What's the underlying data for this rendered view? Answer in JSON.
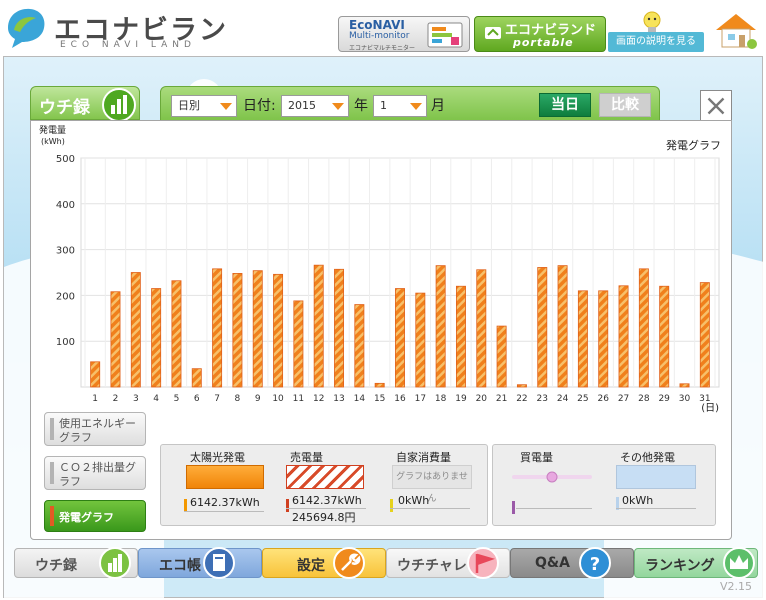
{
  "header": {
    "logo_title": "エコナビランド",
    "logo_sub": "ECO NAVI LAND",
    "econavi": {
      "line1": "EcoNAVI",
      "line2": "Multi-monitor",
      "line3": "エコナビマルチモニター"
    },
    "portable": {
      "line1": "エコナビランド",
      "line2": "portable"
    },
    "help_label": "画面の説明を見る"
  },
  "main_tab": {
    "label": "ウチ録"
  },
  "controls": {
    "period_value": "日別",
    "date_label": "日付:",
    "year_value": "2015",
    "year_unit": "年",
    "month_value": "1",
    "month_unit": "月",
    "today_label": "当日",
    "compare_label": "比較"
  },
  "chart_data": {
    "type": "bar",
    "title": "発電グラフ",
    "ylabel": "発電量",
    "yunit": "(kWh)",
    "xlabel": "(日)",
    "ylim": [
      0,
      500
    ],
    "yticks": [
      100,
      200,
      300,
      400,
      500
    ],
    "grid": true,
    "categories": [
      "1",
      "2",
      "3",
      "4",
      "5",
      "6",
      "7",
      "8",
      "9",
      "10",
      "11",
      "12",
      "13",
      "14",
      "15",
      "16",
      "17",
      "18",
      "19",
      "20",
      "21",
      "22",
      "23",
      "24",
      "25",
      "26",
      "27",
      "28",
      "29",
      "30",
      "31"
    ],
    "values": [
      55,
      208,
      250,
      215,
      232,
      40,
      258,
      248,
      254,
      246,
      188,
      266,
      257,
      180,
      8,
      215,
      205,
      265,
      220,
      256,
      133,
      5,
      261,
      265,
      210,
      210,
      221,
      258,
      220,
      7,
      228
    ],
    "bar_color": "#f0801c",
    "stripe_color": "#f7c06a"
  },
  "side_buttons": {
    "energy": "使用エネルギーグラフ",
    "co2": "ＣＯ２排出量グラフ",
    "generation": "発電グラフ"
  },
  "stats": {
    "solar": {
      "label": "太陽光発電",
      "value": "6142.37kWh",
      "color": "#f39800"
    },
    "sell": {
      "label": "売電量",
      "value": "6142.37kWh",
      "yen": "245694.8円",
      "color": "#d04020"
    },
    "self": {
      "label": "自家消費量",
      "swatch_text": "グラフはありません",
      "value": "0kWh",
      "color": "#e6d21c"
    },
    "buy": {
      "label": "買電量",
      "color": "#9b5aa8"
    },
    "other": {
      "label": "その他発電",
      "value": "0kWh",
      "color": "#b8d2ec"
    }
  },
  "nav": {
    "uchiroku": "ウチ録",
    "ecocho": "エコ帳",
    "settings": "設定",
    "uchichare": "ウチチャレ",
    "qa": "Q&A",
    "ranking": "ランキング"
  },
  "version": "V2.15"
}
